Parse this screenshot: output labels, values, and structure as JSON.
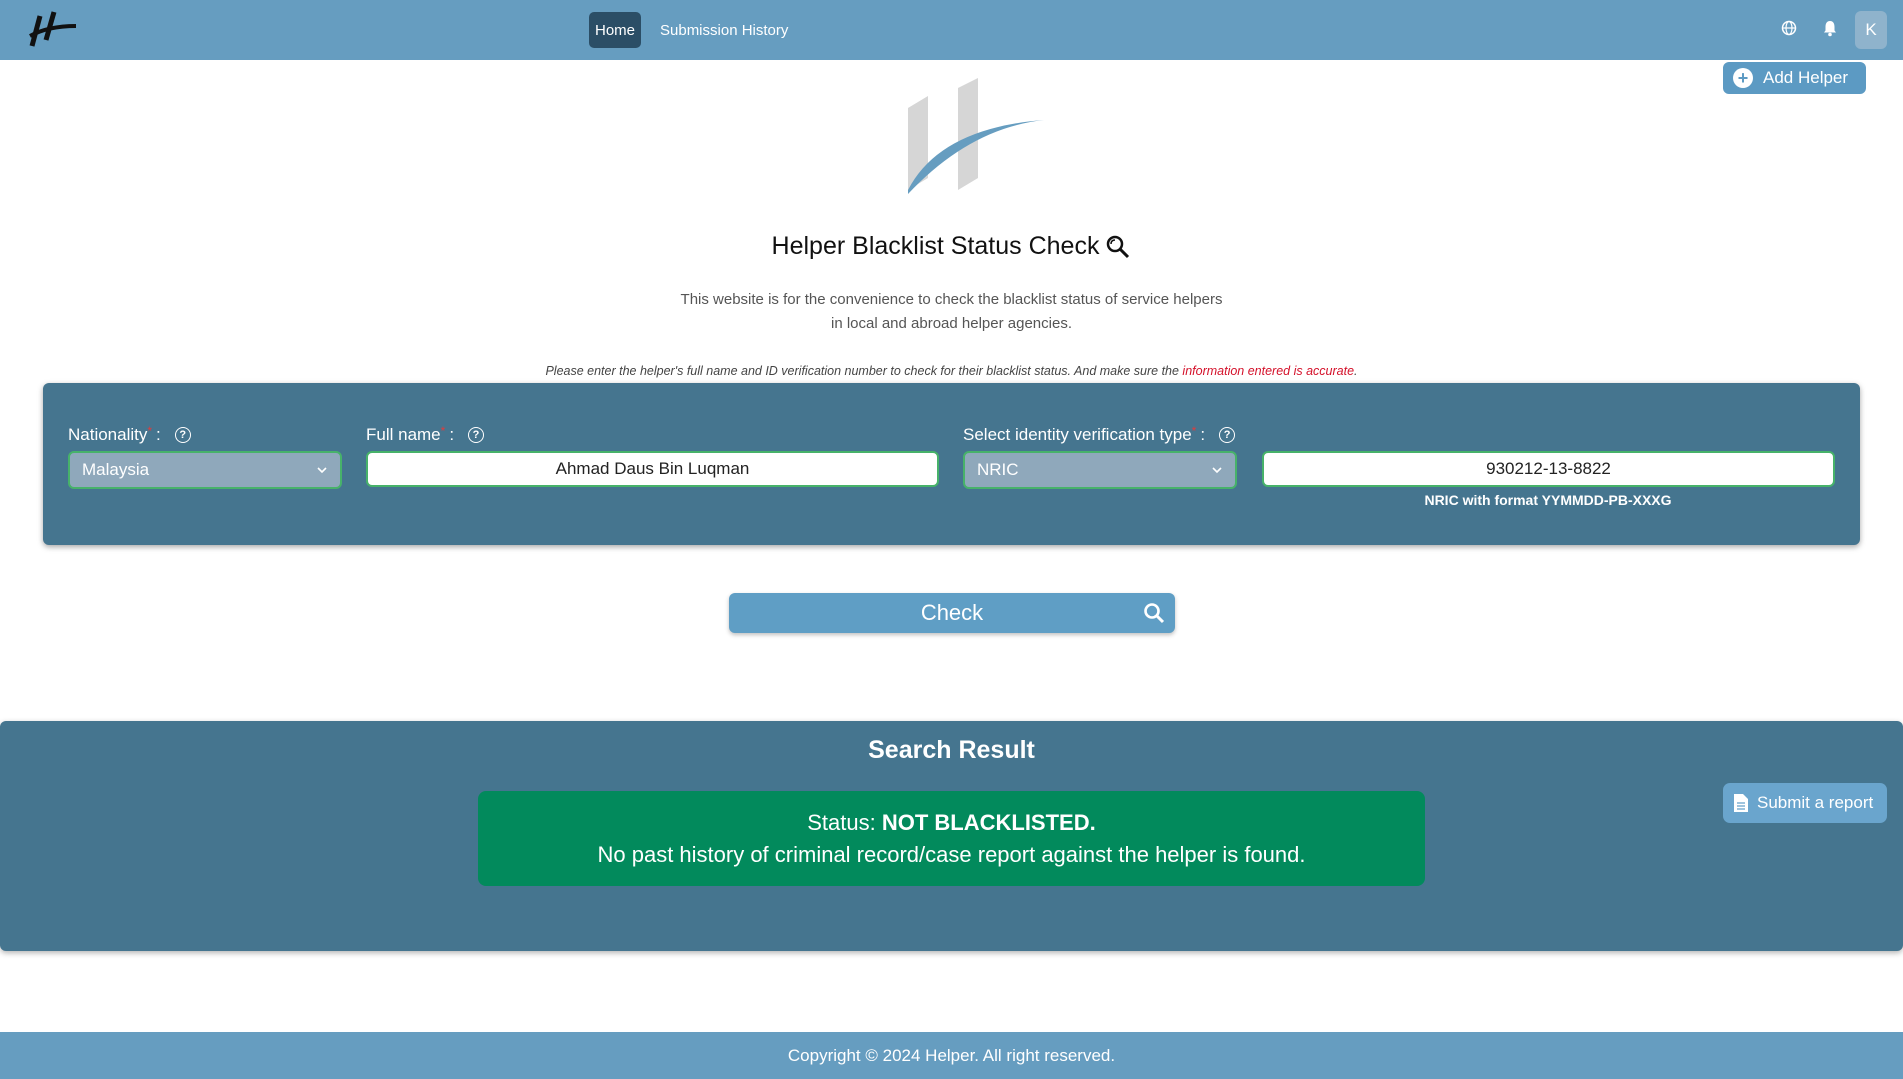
{
  "nav": {
    "home_label": "Home",
    "history_label": "Submission History",
    "avatar_initial": "K",
    "logo_icon": "brand-logo-icon",
    "globe_icon": "globe-icon",
    "bell_icon": "bell-icon"
  },
  "actions": {
    "add_helper_label": "Add Helper",
    "check_label": "Check",
    "report_label": "Submit a report"
  },
  "hero": {
    "title": "Helper Blacklist Status Check",
    "desc_line1": "This website is for the convenience to check the blacklist status of service helpers",
    "desc_line2": "in local and abroad helper agencies.",
    "note_main": "Please enter the helper's full name and ID verification number to check for their blacklist status. And make sure the ",
    "note_red": "information entered is accurate",
    "note_end": "."
  },
  "form": {
    "nationality_label": "Nationality",
    "nationality_value": "Malaysia",
    "fullname_label": "Full name",
    "fullname_value": "Ahmad Daus Bin Luqman",
    "idtype_label": "Select identity verification type",
    "idtype_value": "NRIC",
    "id_value": "930212-13-8822",
    "id_hint": "NRIC with format YYMMDD-PB-XXXG",
    "required_mark": "*",
    "colon": ":"
  },
  "result": {
    "title": "Search Result",
    "status_prefix": "Status: ",
    "status_value": "NOT BLACKLISTED.",
    "status_detail": "No past history of criminal record/case report against the helper is found."
  },
  "footer": {
    "copyright": "Copyright © 2024 Helper. All right reserved."
  },
  "colors": {
    "header": "#669dc0",
    "panel": "#45758f",
    "success": "#028a5c",
    "accent": "#5f9ec5",
    "required": "#d4112a"
  }
}
